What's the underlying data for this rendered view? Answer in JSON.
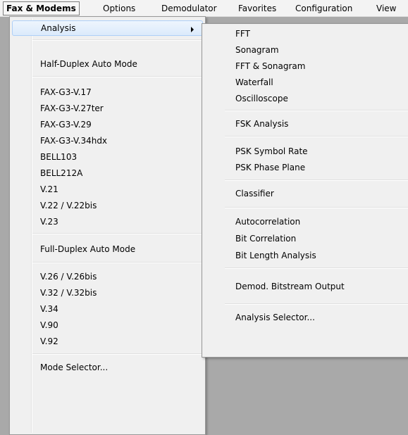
{
  "menubar": {
    "items": [
      "Fax & Modems",
      "Options",
      "Demodulator",
      "Favorites",
      "Configuration",
      "View"
    ]
  },
  "main_menu": {
    "items": [
      "Analysis",
      "Half-Duplex Auto Mode",
      "FAX-G3-V.17",
      "FAX-G3-V.27ter",
      "FAX-G3-V.29",
      "FAX-G3-V.34hdx",
      "BELL103",
      "BELL212A",
      "V.21",
      "V.22 / V.22bis",
      "V.23",
      "Full-Duplex Auto Mode",
      "V.26 / V.26bis",
      "V.32 / V.32bis",
      "V.34",
      "V.90",
      "V.92",
      "Mode Selector..."
    ]
  },
  "sub_menu": {
    "items": [
      "FFT",
      "Sonagram",
      "FFT & Sonagram",
      "Waterfall",
      "Oscilloscope",
      "FSK Analysis",
      "PSK Symbol Rate",
      "PSK Phase Plane",
      "Classifier",
      "Autocorrelation",
      "Bit Correlation",
      "Bit Length Analysis",
      "Demod. Bitstream Output",
      "Analysis Selector..."
    ]
  }
}
